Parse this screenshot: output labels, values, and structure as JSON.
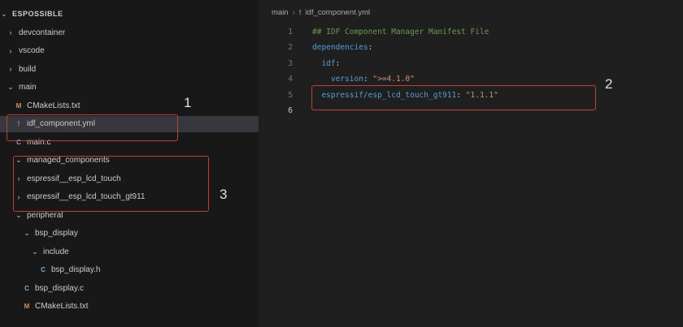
{
  "explorer": {
    "root": "ESPOSSIBLE",
    "items": [
      {
        "chev": "›",
        "icon": "",
        "label": "devcontainer"
      },
      {
        "chev": "›",
        "icon": "",
        "label": "vscode"
      },
      {
        "chev": "›",
        "icon": "",
        "label": "build"
      },
      {
        "chev": "⌄",
        "icon": "",
        "label": "main"
      },
      {
        "chev": "",
        "icon": "M",
        "label": "CMakeLists.txt"
      },
      {
        "chev": "",
        "icon": "!",
        "label": "idf_component.yml"
      },
      {
        "chev": "",
        "icon": "C",
        "label": "main.c"
      },
      {
        "chev": "⌄",
        "icon": "",
        "label": "managed_components"
      },
      {
        "chev": "›",
        "icon": "",
        "label": "espressif__esp_lcd_touch"
      },
      {
        "chev": "›",
        "icon": "",
        "label": "espressif__esp_lcd_touch_gt911"
      },
      {
        "chev": "⌄",
        "icon": "",
        "label": "peripheral"
      },
      {
        "chev": "⌄",
        "icon": "",
        "label": "bsp_display"
      },
      {
        "chev": "⌄",
        "icon": "",
        "label": "include"
      },
      {
        "chev": "",
        "icon": "C",
        "label": "bsp_display.h"
      },
      {
        "chev": "",
        "icon": "C",
        "label": "bsp_display.c"
      },
      {
        "chev": "",
        "icon": "M",
        "label": "CMakeLists.txt"
      }
    ]
  },
  "editor": {
    "breadcrumb": [
      "main",
      "idf_component.yml"
    ],
    "lines": [
      {
        "num": "1",
        "parts": [
          {
            "t": "## IDF Component Manager Manifest File",
            "c": "comment"
          }
        ]
      },
      {
        "num": "2",
        "parts": [
          {
            "t": "dependencies",
            "c": "key"
          },
          {
            "t": ":",
            "c": "punc"
          }
        ]
      },
      {
        "num": "3",
        "parts": [
          {
            "t": "  ",
            "c": "punc"
          },
          {
            "t": "idf",
            "c": "key"
          },
          {
            "t": ":",
            "c": "punc"
          }
        ]
      },
      {
        "num": "4",
        "parts": [
          {
            "t": "    ",
            "c": "punc"
          },
          {
            "t": "version",
            "c": "key"
          },
          {
            "t": ": ",
            "c": "punc"
          },
          {
            "t": "\">=4.1.0\"",
            "c": "str"
          }
        ]
      },
      {
        "num": "5",
        "parts": [
          {
            "t": "  ",
            "c": "punc"
          },
          {
            "t": "espressif/esp_lcd_touch_gt911",
            "c": "key"
          },
          {
            "t": ": ",
            "c": "punc"
          },
          {
            "t": "\"1.1.1\"",
            "c": "str"
          }
        ]
      },
      {
        "num": "6",
        "parts": []
      }
    ]
  },
  "callouts": [
    "1",
    "2",
    "3"
  ],
  "colors": {
    "highlight": "#c0403a",
    "selected": "#37373d"
  }
}
